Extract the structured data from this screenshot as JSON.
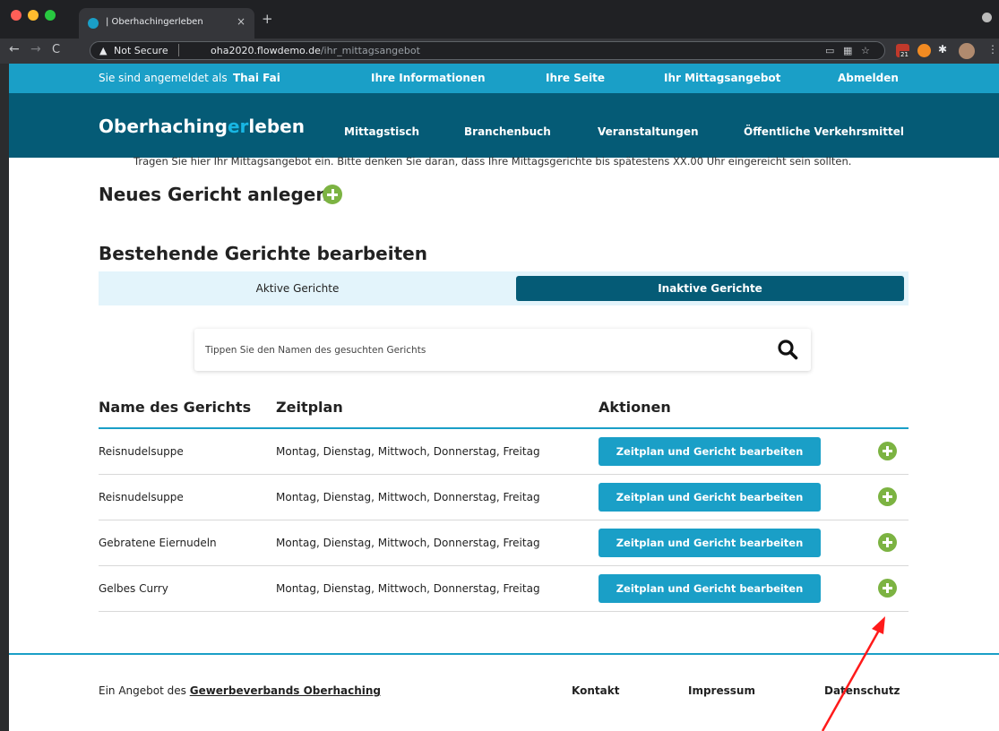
{
  "browser": {
    "tab_title": "| Oberhachingerleben",
    "tab_close": "×",
    "new_tab": "+",
    "security_label": "Not Secure",
    "url_domain": "oha2020.flowdemo.de",
    "url_path": "/ihr_mittagsangebot",
    "extension_badge": "21"
  },
  "topbar": {
    "logged_in_prefix": "Sie sind angemeldet als",
    "user_name": "Thai Fai",
    "links": [
      "Ihre Informationen",
      "Ihre Seite",
      "Ihr Mittagsangebot",
      "Abmelden"
    ]
  },
  "mainnav": {
    "logo_part1": "Oberhaching",
    "logo_part2": "er",
    "logo_part3": "leben",
    "items": [
      "Mittagstisch",
      "Branchenbuch",
      "Veranstaltungen",
      "Öffentliche Verkehrsmittel"
    ]
  },
  "content": {
    "intro": "Tragen Sie hier Ihr Mittagsangebot ein. Bitte denken Sie daran, dass Ihre Mittagsgerichte bis spätestens XX.00 Uhr eingereicht sein sollten.",
    "new_heading": "Neues Gericht anlegen",
    "edit_heading": "Bestehende Gerichte bearbeiten",
    "tab_active": "Aktive Gerichte",
    "tab_inactive": "Inaktive Gerichte",
    "search_placeholder": "Tippen Sie den Namen des gesuchten Gerichts",
    "columns": [
      "Name des Gerichts",
      "Zeitplan",
      "Aktionen"
    ],
    "rows": [
      {
        "name": "Reisnudelsuppe",
        "schedule": "Montag, Dienstag, Mittwoch, Donnerstag, Freitag",
        "action": "Zeitplan und Gericht bearbeiten"
      },
      {
        "name": "Reisnudelsuppe",
        "schedule": "Montag, Dienstag, Mittwoch, Donnerstag, Freitag",
        "action": "Zeitplan und Gericht bearbeiten"
      },
      {
        "name": "Gebratene Eiernudeln",
        "schedule": "Montag, Dienstag, Mittwoch, Donnerstag, Freitag",
        "action": "Zeitplan und Gericht bearbeiten"
      },
      {
        "name": "Gelbes Curry",
        "schedule": "Montag, Dienstag, Mittwoch, Donnerstag, Freitag",
        "action": "Zeitplan und Gericht bearbeiten"
      }
    ]
  },
  "footer": {
    "prefix": "Ein Angebot des",
    "org_link": "Gewerbeverbands Oberhaching",
    "links": [
      "Kontakt",
      "Impressum",
      "Datenschutz"
    ]
  },
  "colors": {
    "accent": "#1a9fc7",
    "dark_teal": "#055b76",
    "plus_green": "#7cb342",
    "annotation_arrow": "#ff0000"
  }
}
